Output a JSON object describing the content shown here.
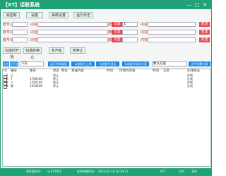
{
  "window": {
    "title": "【XT】话联系统",
    "min": "—",
    "max": "□",
    "close": "✕"
  },
  "toolbar": [
    "桌控制",
    "设置",
    "系统设置",
    "运行日志"
  ],
  "accounts": [
    {
      "label": "群号1",
      "content_label": "内容",
      "send": "发送",
      "value": ""
    },
    {
      "label": "群号2",
      "content_label": "内容",
      "send": "发送",
      "value": ""
    },
    {
      "label": "群号3",
      "content_label": "内容",
      "send": "发送",
      "value": ""
    },
    {
      "label": "群号1",
      "content_label": "内容",
      "send": "发送",
      "value": "1"
    },
    {
      "label": "群号2",
      "content_label": "内容",
      "send": "发送",
      "value": ""
    },
    {
      "label": "群号3",
      "content_label": "内容",
      "send": "发送",
      "value": ""
    }
  ],
  "actions": [
    "勾选的开始",
    "勾选的停止",
    "全开始",
    "全停止"
  ],
  "controls": {
    "select_all": "全选",
    "select_none": "全不选",
    "filter_value": "下车",
    "btn1": "运行所有链接",
    "btn2": "勾选账号上线",
    "btn3": "勾选账号退出",
    "btn4": "勾选账号成功方案",
    "scheme_placeholder": "默认方案",
    "btn5": "选中切换方案"
  },
  "table": {
    "headers": [
      "ID",
      "编号",
      "账号",
      "状态",
      "积分",
      "发送内容",
      "时间",
      "环境的内容",
      "时间",
      "方案",
      "在线状态"
    ],
    "rows": [
      {
        "id": "1",
        "name": "小",
        "account": "",
        "state": "停止",
        "online": "在线"
      },
      {
        "id": "2",
        "name": "7",
        "account": "1760568",
        "state": "停止",
        "online": "在线"
      },
      {
        "id": "3",
        "name": "人",
        "account": "1356546",
        "state": "停止",
        "online": "在线"
      },
      {
        "id": "4",
        "name": "数",
        "account": "1454648",
        "state": "停止",
        "online": "在线"
      }
    ]
  },
  "status": {
    "owner": "软件版本号：",
    "owner_val": "v1077945",
    "time_label": "软件到期时间：",
    "time_val": "2023-02-10 16:34:11",
    "mode": "XTT",
    "count_label": "100",
    "count_val": "108"
  }
}
